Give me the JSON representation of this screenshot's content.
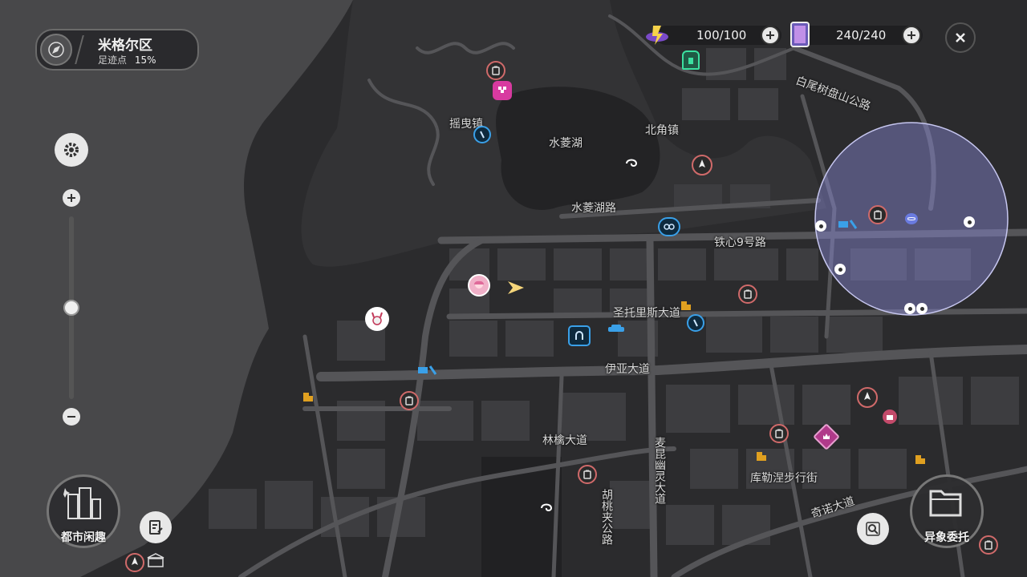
{
  "location": {
    "name": "米格尔区",
    "progress_label": "足迹点",
    "progress_value": "15%"
  },
  "resources": [
    {
      "icon": "battery-icon",
      "value": "100/100"
    },
    {
      "icon": "card-icon",
      "value": "240/240"
    }
  ],
  "map_labels": {
    "yaoye": "摇曳镇",
    "shuiling_lake": "水菱湖",
    "beijiao": "北角镇",
    "shuiling_road": "水菱湖路",
    "tiexin": "铁心9号路",
    "baiwei": "白尾树盘山公路",
    "shengtuo": "圣托里斯大道",
    "yiya": "伊亚大道",
    "linqin": "林檎大道",
    "maikun": "麦昆幽灵大道",
    "hutao": "胡桃夹公路",
    "kule": "库勒涅步行街",
    "qinuo": "奇诺大道"
  },
  "bottom_left": {
    "label": "都市闲趣"
  },
  "bottom_right": {
    "label": "异象委托"
  },
  "colors": {
    "accent_red": "#d15a5a",
    "accent_blue": "#3aa0e8",
    "gold": "#e0a020",
    "highlight": "#8a8ad8"
  }
}
